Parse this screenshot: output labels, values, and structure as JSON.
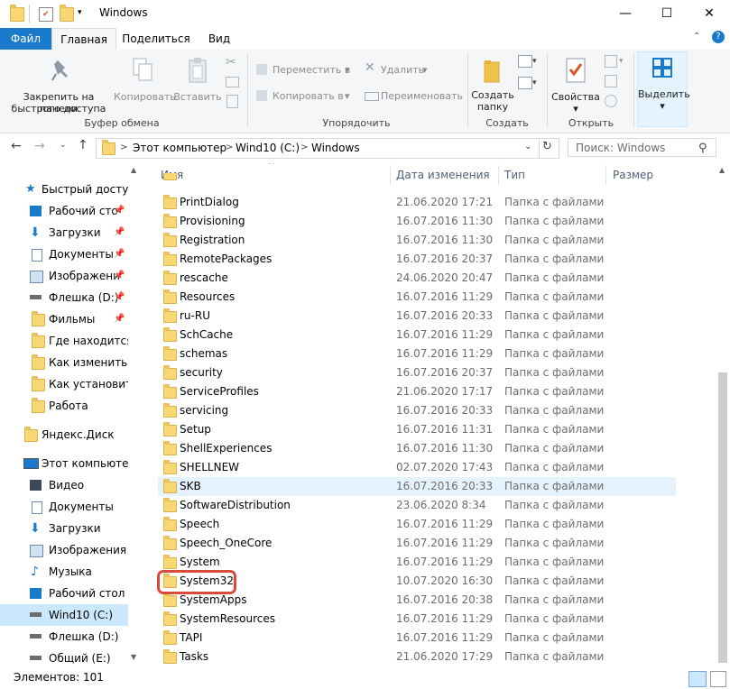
{
  "window": {
    "title": "Windows",
    "minimize": "—",
    "maximize": "☐",
    "close": "✕"
  },
  "tabs": {
    "file": "Файл",
    "home": "Главная",
    "share": "Поделиться",
    "view": "Вид"
  },
  "ribbon": {
    "pin_quick_access": "Закрепить на панели быстрого доступа",
    "pin_line1": "Закрепить на панели",
    "pin_line2": "быстрого доступа",
    "copy": "Копировать",
    "paste": "Вставить",
    "clipboard_group": "Буфер обмена",
    "move_to": "Переместить в",
    "copy_to": "Копировать в",
    "delete": "Удалить",
    "rename": "Переименовать",
    "organize_group": "Упорядочить",
    "new_folder_line1": "Создать",
    "new_folder_line2": "папку",
    "new_group": "Создать",
    "properties": "Свойства",
    "open_group": "Открыть",
    "select": "Выделить"
  },
  "address": {
    "crumbs": [
      "Этот компьютер",
      "Wind10 (C:)",
      "Windows"
    ],
    "search_placeholder": "Поиск: Windows"
  },
  "nav": {
    "quick_access": "Быстрый доступ",
    "items": [
      {
        "label": "Рабочий сто",
        "pinned": true
      },
      {
        "label": "Загрузки",
        "pinned": true
      },
      {
        "label": "Документы",
        "pinned": true
      },
      {
        "label": "Изображени",
        "pinned": true
      },
      {
        "label": "Флешка (D:)",
        "pinned": true
      },
      {
        "label": "Фильмы",
        "pinned": true
      },
      {
        "label": "Где находится ф",
        "pinned": false
      },
      {
        "label": "Как изменить ф",
        "pinned": false
      },
      {
        "label": "Как установить",
        "pinned": false
      },
      {
        "label": "Работа",
        "pinned": false
      }
    ],
    "yandex": "Яндекс.Диск",
    "this_pc": "Этот компьютер",
    "pc_items": [
      "Видео",
      "Документы",
      "Загрузки",
      "Изображения",
      "Музыка",
      "Рабочий стол",
      "Wind10 (C:)",
      "Флешка (D:)",
      "Общий (E:)"
    ]
  },
  "columns": {
    "name": "Имя",
    "date": "Дата изменения",
    "type": "Тип",
    "size": "Размер"
  },
  "files": [
    {
      "name": "PrintDialog",
      "date": "21.06.2020 17:21",
      "type": "Папка с файлами"
    },
    {
      "name": "Provisioning",
      "date": "16.07.2016 11:30",
      "type": "Папка с файлами"
    },
    {
      "name": "Registration",
      "date": "16.07.2016 11:30",
      "type": "Папка с файлами"
    },
    {
      "name": "RemotePackages",
      "date": "16.07.2016 20:37",
      "type": "Папка с файлами"
    },
    {
      "name": "rescache",
      "date": "24.06.2020 20:47",
      "type": "Папка с файлами"
    },
    {
      "name": "Resources",
      "date": "16.07.2016 11:29",
      "type": "Папка с файлами"
    },
    {
      "name": "ru-RU",
      "date": "16.07.2016 20:33",
      "type": "Папка с файлами"
    },
    {
      "name": "SchCache",
      "date": "16.07.2016 11:29",
      "type": "Папка с файлами"
    },
    {
      "name": "schemas",
      "date": "16.07.2016 11:29",
      "type": "Папка с файлами"
    },
    {
      "name": "security",
      "date": "16.07.2016 20:37",
      "type": "Папка с файлами"
    },
    {
      "name": "ServiceProfiles",
      "date": "21.06.2020 17:17",
      "type": "Папка с файлами"
    },
    {
      "name": "servicing",
      "date": "16.07.2016 20:33",
      "type": "Папка с файлами"
    },
    {
      "name": "Setup",
      "date": "16.07.2016 11:31",
      "type": "Папка с файлами"
    },
    {
      "name": "ShellExperiences",
      "date": "16.07.2016 11:30",
      "type": "Папка с файлами"
    },
    {
      "name": "SHELLNEW",
      "date": "02.07.2020 17:43",
      "type": "Папка с файлами"
    },
    {
      "name": "SKB",
      "date": "16.07.2016 20:33",
      "type": "Папка с файлами"
    },
    {
      "name": "SoftwareDistribution",
      "date": "23.06.2020 8:34",
      "type": "Папка с файлами"
    },
    {
      "name": "Speech",
      "date": "16.07.2016 11:29",
      "type": "Папка с файлами"
    },
    {
      "name": "Speech_OneCore",
      "date": "16.07.2016 11:29",
      "type": "Папка с файлами"
    },
    {
      "name": "System",
      "date": "16.07.2016 11:29",
      "type": "Папка с файлами"
    },
    {
      "name": "System32",
      "date": "10.07.2020 16:30",
      "type": "Папка с файлами"
    },
    {
      "name": "SystemApps",
      "date": "16.07.2016 20:38",
      "type": "Папка с файлами"
    },
    {
      "name": "SystemResources",
      "date": "16.07.2016 11:29",
      "type": "Папка с файлами"
    },
    {
      "name": "TAPI",
      "date": "16.07.2016 11:29",
      "type": "Папка с файлами"
    },
    {
      "name": "Tasks",
      "date": "21.06.2020 17:29",
      "type": "Папка с файлами"
    }
  ],
  "status": {
    "count": "Элементов: 101"
  }
}
